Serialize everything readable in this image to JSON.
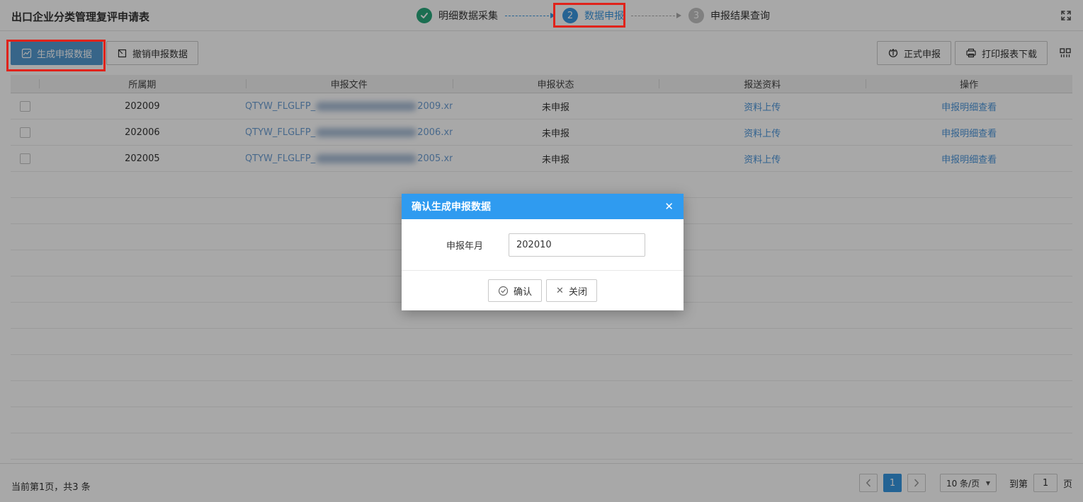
{
  "page": {
    "title": "出口企业分类管理复评申请表"
  },
  "colors": {
    "primary_blue": "#3A97E0",
    "toolbar_button_blue": "#5499D1",
    "modal_header_blue": "#2F9BF0",
    "step_done_green": "#29A87C",
    "step_pending_gray": "#C2C2C2",
    "active_page_blue": "#3696E1",
    "annotation_red": "#E0231B",
    "link_blue": "#4D96DB"
  },
  "steps": [
    {
      "label": "明细数据采集",
      "status": "done",
      "icon": "check-icon"
    },
    {
      "label": "数据申报",
      "status": "active",
      "number": "2"
    },
    {
      "label": "申报结果查询",
      "status": "pending",
      "number": "3"
    }
  ],
  "toolbar": {
    "generate_label": "生成申报数据",
    "revoke_label": "撤销申报数据",
    "formal_label": "正式申报",
    "print_label": "打印报表下载",
    "icons": {
      "generate": "chart-icon",
      "revoke": "undo-box-icon",
      "formal": "upload-circle-icon",
      "print": "printer-icon",
      "columns": "column-settings-icon"
    }
  },
  "table": {
    "headers": [
      "所属期",
      "申报文件",
      "申报状态",
      "报送资料",
      "操作"
    ],
    "rows": [
      {
        "period": "202009",
        "file_prefix": "QTYW_FLGLFP_",
        "file_suffix": "2009.xr",
        "status": "未申报",
        "material_link": "资料上传",
        "action_link": "申报明细查看"
      },
      {
        "period": "202006",
        "file_prefix": "QTYW_FLGLFP_",
        "file_suffix": "2006.xr",
        "status": "未申报",
        "material_link": "资料上传",
        "action_link": "申报明细查看"
      },
      {
        "period": "202005",
        "file_prefix": "QTYW_FLGLFP_",
        "file_suffix": "2005.xr",
        "status": "未申报",
        "material_link": "资料上传",
        "action_link": "申报明细查看"
      }
    ]
  },
  "dialog": {
    "title": "确认生成申报数据",
    "close_glyph": "✕",
    "field_label": "申报年月",
    "field_value": "202010",
    "confirm_label": "确认",
    "close_label": "关闭",
    "close_button_glyph": "✕"
  },
  "footer": {
    "summary": "当前第1页，共3 条",
    "prev_glyph": "❮",
    "next_glyph": "❯",
    "current_page": "1",
    "page_size_label": "10 条/页",
    "caret_glyph": "▼",
    "goto_prefix": "到第",
    "goto_value": "1",
    "goto_suffix": "页"
  }
}
